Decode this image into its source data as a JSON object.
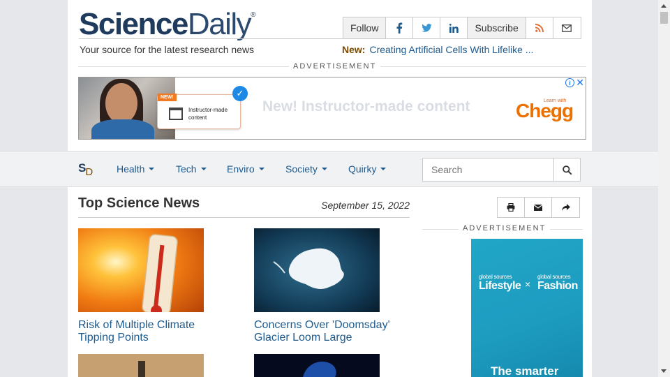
{
  "header": {
    "logo_bold": "Science",
    "logo_light": "Daily",
    "logo_mark": "®",
    "tagline": "Your source for the latest research news",
    "follow_label": "Follow",
    "subscribe_label": "Subscribe",
    "new_label": "New:",
    "new_title": "Creating Artificial Cells With Lifelike ..."
  },
  "ads": {
    "label": "ADVERTISEMENT",
    "banner": {
      "tag": "NEW!",
      "card_text": "Instructor-made content",
      "headline": "New! Instructor-made content",
      "brand_small": "Learn with",
      "brand": "Chegg",
      "info": "i",
      "close": "✕"
    },
    "side": {
      "brand_small_1": "global sources",
      "brand_big_1": "Lifestyle",
      "times": "×",
      "brand_small_2": "global sources",
      "brand_big_2": "Fashion",
      "tagline": "The smarter"
    }
  },
  "nav": {
    "logo_s": "S",
    "logo_d": "D",
    "items": [
      {
        "label": "Health"
      },
      {
        "label": "Tech"
      },
      {
        "label": "Enviro"
      },
      {
        "label": "Society"
      },
      {
        "label": "Quirky"
      }
    ],
    "search_placeholder": "Search"
  },
  "main": {
    "section_title": "Top Science News",
    "date": "September 15, 2022",
    "stories": [
      {
        "title": "Risk of Multiple Climate Tipping Points",
        "image_icon": "thermometer-heat-image"
      },
      {
        "title": "Concerns Over 'Doomsday' Glacier Loom Large",
        "image_icon": "antarctica-satellite-image"
      }
    ]
  },
  "colors": {
    "brand_navy": "#1e3a5c",
    "link_blue": "#1d5a8e",
    "new_brown": "#7a4a00",
    "rss_orange": "#e66a2c",
    "chegg_orange": "#eb7100",
    "side_ad_teal": "#1d9cc0"
  }
}
